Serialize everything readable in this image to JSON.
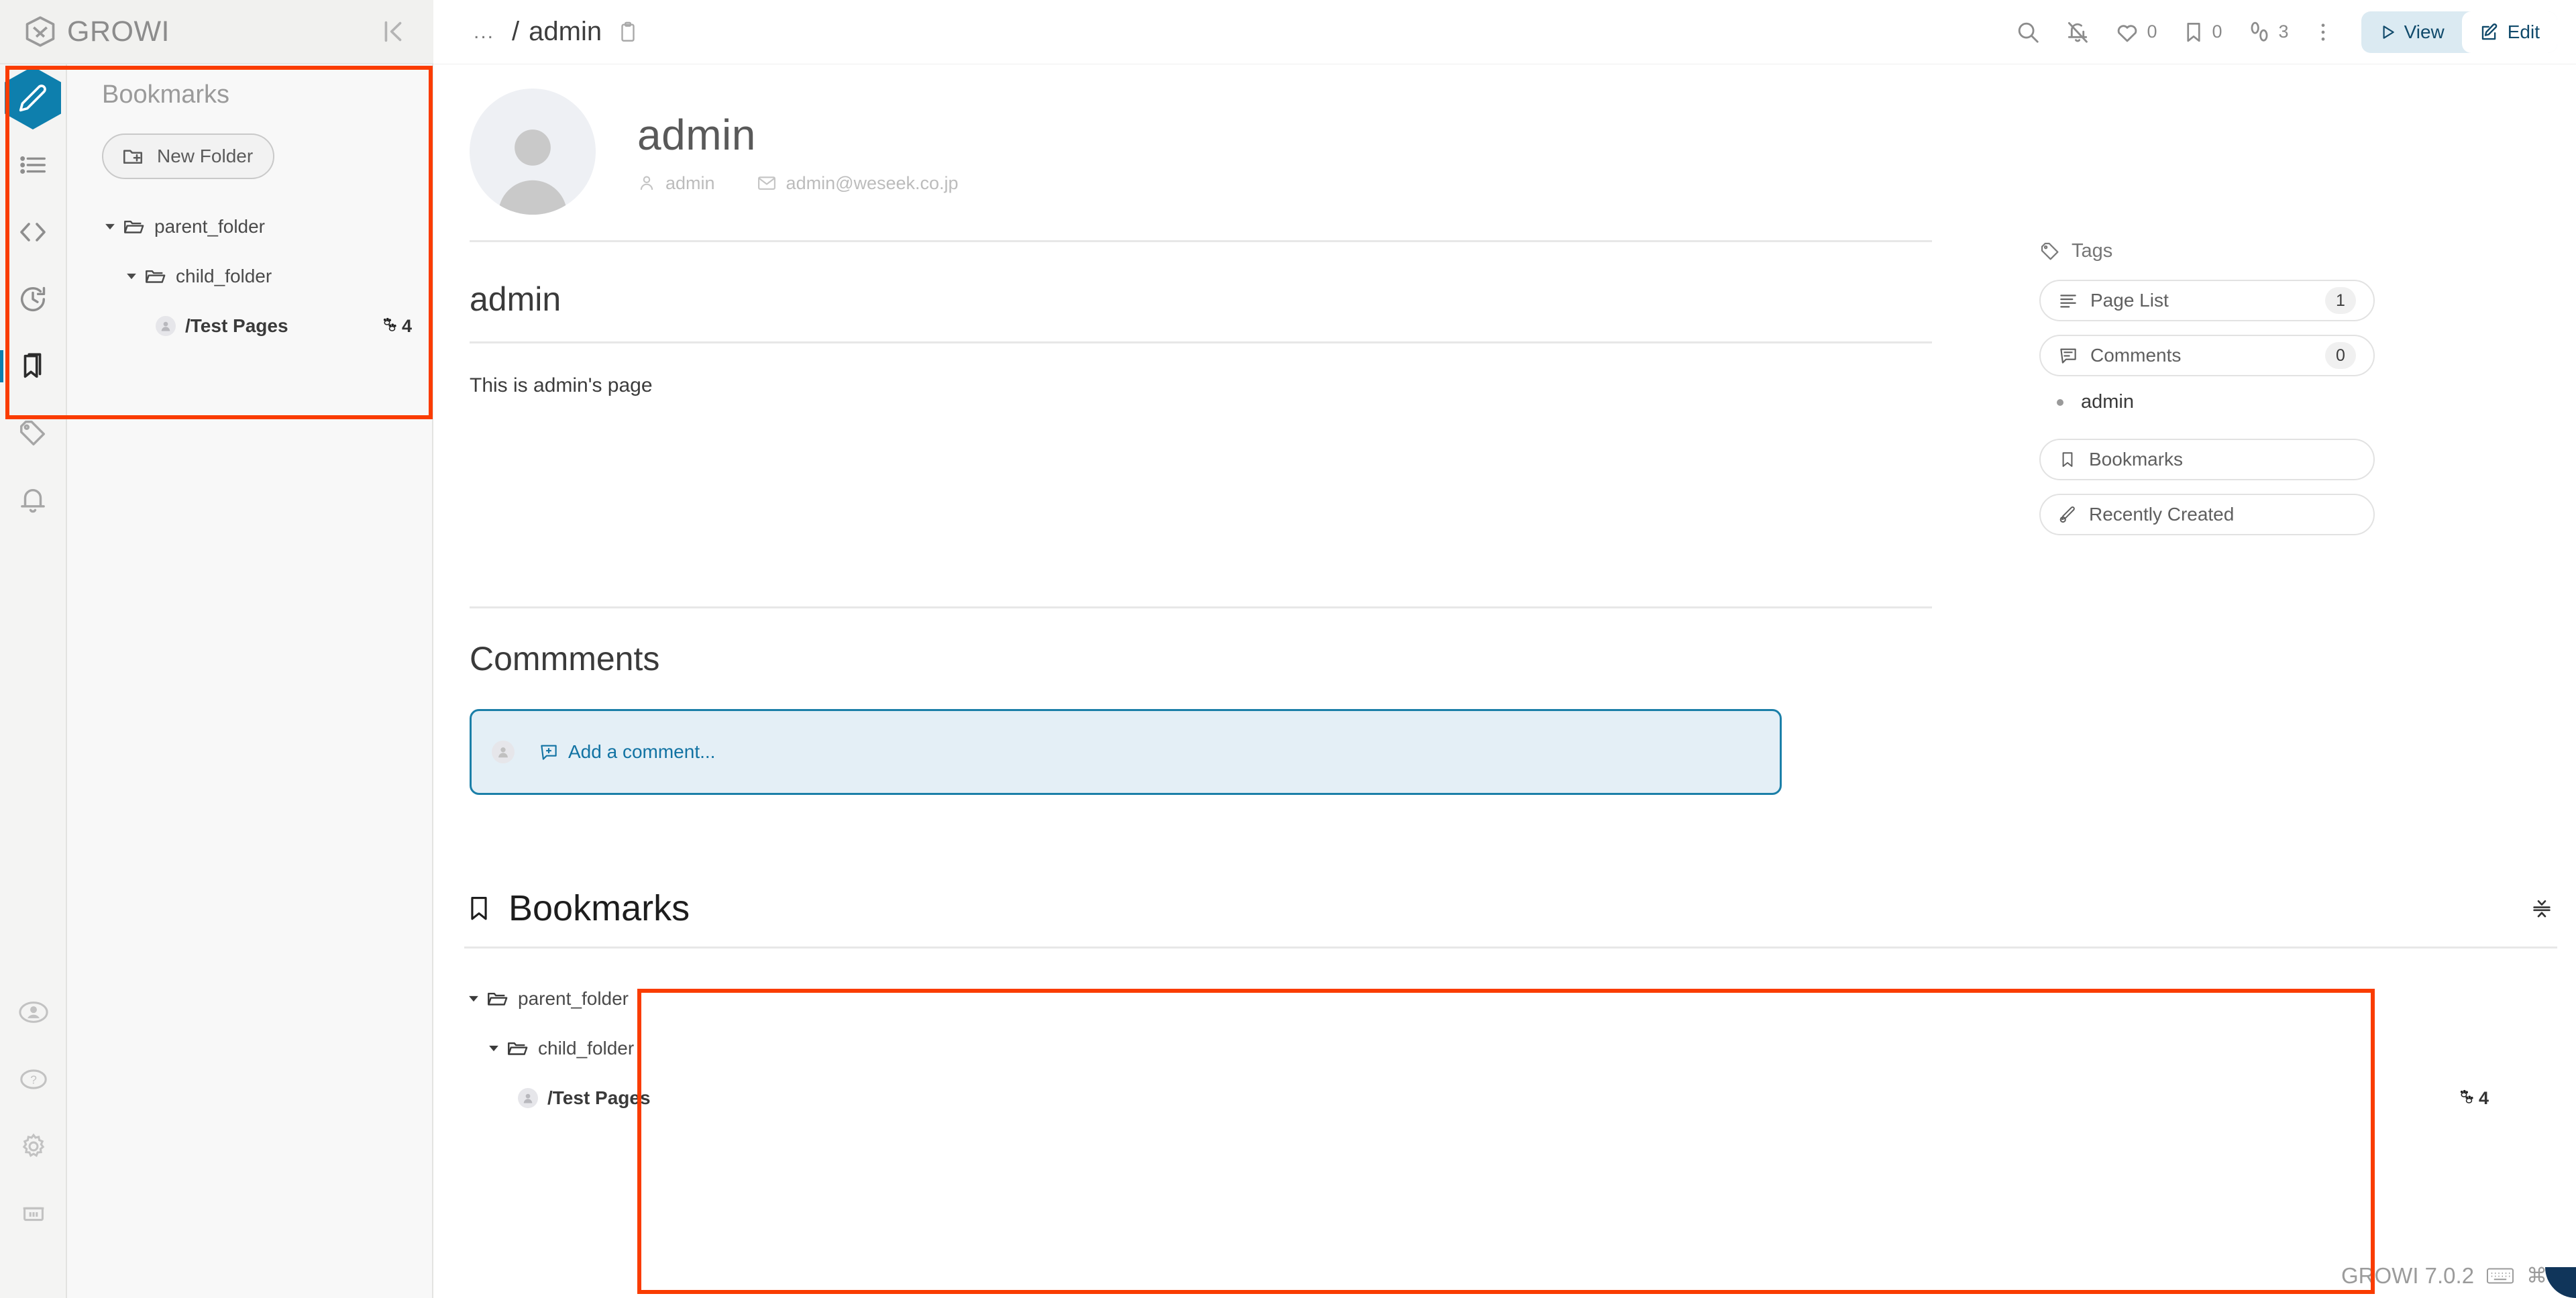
{
  "app": {
    "brand": "GROWI",
    "version_label": "GROWI 7.0.2",
    "shortcut_label": "⌘-/"
  },
  "sidebar": {
    "title": "Bookmarks",
    "new_folder_label": "New Folder",
    "tree": [
      {
        "label": "parent_folder",
        "type": "folder",
        "level": 0,
        "expanded": true
      },
      {
        "label": "child_folder",
        "type": "folder",
        "level": 1,
        "expanded": true
      },
      {
        "label": "/Test Pages",
        "type": "page",
        "level": 2,
        "count": "4"
      }
    ],
    "rail_icons": [
      "editor-pencil-icon",
      "page-list-icon",
      "code-brackets-icon",
      "recent-changes-clock-icon",
      "bookmarks-icon",
      "tag-icon",
      "notification-bell-icon",
      "user-account-icon",
      "help-question-icon",
      "settings-gear-icon",
      "trash-icon"
    ]
  },
  "topbar": {
    "breadcrumb_ellipsis": "...",
    "breadcrumb_separator": "/",
    "breadcrumb_page": "admin",
    "copy_icon": "clipboard-icon",
    "search_icon": "search-icon",
    "bell_off_icon": "bell-off-icon",
    "like_count": "0",
    "bookmark_count": "0",
    "seen_count": "3",
    "more_icon": "three-dots-vertical-icon",
    "view_label": "View",
    "edit_label": "Edit",
    "selected_mode": "Edit"
  },
  "profile": {
    "display_name": "admin",
    "username": "admin",
    "email": "admin@weseek.co.jp"
  },
  "page": {
    "heading": "admin",
    "body": "This is admin's page"
  },
  "comments": {
    "title": "Commments",
    "add_label": "Add a comment..."
  },
  "bookmarks_panel": {
    "title": "Bookmarks",
    "fold_icon": "collapse-vertical-icon",
    "tree": [
      {
        "label": "parent_folder",
        "type": "folder",
        "level": 0,
        "expanded": true
      },
      {
        "label": "child_folder",
        "type": "folder",
        "level": 1,
        "expanded": true
      },
      {
        "label": "/Test Pages",
        "type": "page",
        "level": 2,
        "count": "4"
      }
    ]
  },
  "right_panel": {
    "tags_label": "Tags",
    "items": [
      {
        "label": "Page List",
        "count": "1",
        "icon": "list-icon"
      },
      {
        "label": "Comments",
        "count": "0",
        "icon": "comment-icon"
      }
    ],
    "list_entry": "admin",
    "buttons": [
      {
        "label": "Bookmarks",
        "icon": "bookmark-icon"
      },
      {
        "label": "Recently Created",
        "icon": "pen-clock-icon"
      }
    ]
  },
  "colors": {
    "accent_blue": "#0e7fad",
    "annotation_red": "#fa3c00",
    "view_edit_bg": "#dbeaf2",
    "comment_box_bg": "#e4eff6"
  }
}
